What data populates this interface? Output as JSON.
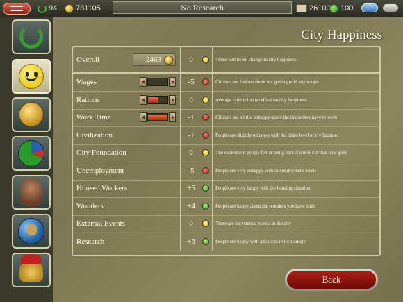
{
  "topbar": {
    "menu_icon": "menu-icon",
    "laurels": "94",
    "gold": "731105",
    "research": "No Research",
    "population": "26100",
    "happiness": "100"
  },
  "sidebar": {
    "items": [
      {
        "name": "wreath-icon",
        "active": false
      },
      {
        "name": "smiley-icon",
        "active": true
      },
      {
        "name": "gold-coin-icon",
        "active": false
      },
      {
        "name": "pie-chart-icon",
        "active": false
      },
      {
        "name": "bust-icon",
        "active": false
      },
      {
        "name": "globe-icon",
        "active": false
      },
      {
        "name": "helmet-icon",
        "active": false
      }
    ]
  },
  "page": {
    "title": "City Happiness"
  },
  "overall": {
    "label": "Overall",
    "total": "2463",
    "value": "0",
    "face": "yellow",
    "message": "There will be no change in city happiness"
  },
  "rows": [
    {
      "label": "Wages",
      "value": "-5",
      "face": "red",
      "message": "Citizens are furious about not getting paid any wages",
      "slider": 0.0
    },
    {
      "label": "Rations",
      "value": "0",
      "face": "yellow",
      "message": "Average rations has no effect on city happiness",
      "slider": 0.55
    },
    {
      "label": "Work Time",
      "value": "-1",
      "face": "red",
      "message": "Citizens are a little unhappy about the hours they have to work",
      "slider": 1.0
    },
    {
      "label": "Civilization",
      "value": "-1",
      "face": "red",
      "message": "People are slightly unhappy with the cities level of civilization"
    },
    {
      "label": "City Foundation",
      "value": "0",
      "face": "yellow",
      "message": "The excitement people felt at being part of a new city has now gone"
    },
    {
      "label": "Unemployment",
      "value": "-5",
      "face": "red",
      "message": "People are very unhappy with unemployment levels"
    },
    {
      "label": "Housed Workers",
      "value": "+5",
      "face": "green",
      "message": "People are very happy with the housing situation"
    },
    {
      "label": "Wonders",
      "value": "+4",
      "face": "green",
      "message": "People are happy about the wonders you have built"
    },
    {
      "label": "External Events",
      "value": "0",
      "face": "yellow",
      "message": "There are no external events in the city"
    },
    {
      "label": "Research",
      "value": "+3",
      "face": "green",
      "message": "People are happy with advances in technology"
    }
  ],
  "back_label": "Back"
}
